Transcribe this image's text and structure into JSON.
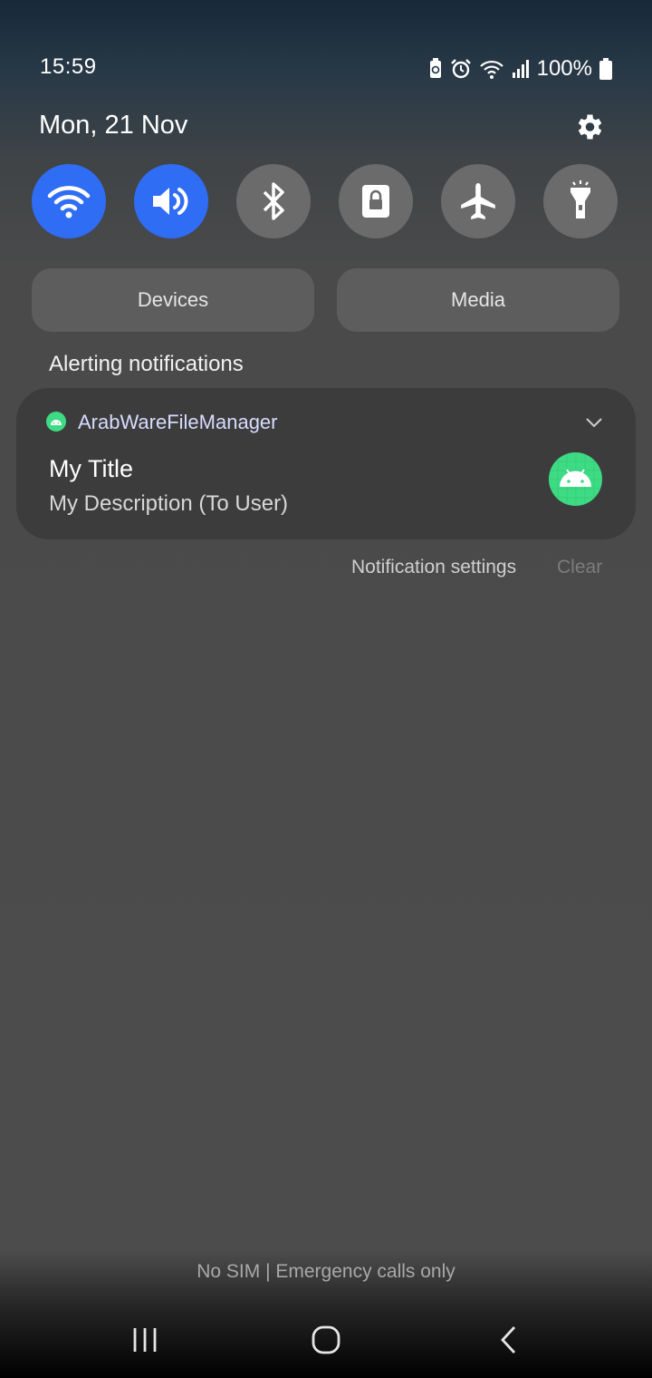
{
  "status_bar": {
    "time": "15:59",
    "battery_text": "100%",
    "icons": [
      "battery-saver-icon",
      "alarm-icon",
      "wifi-signal-icon",
      "cell-signal-icon",
      "battery-icon"
    ]
  },
  "header": {
    "date": "Mon, 21 Nov",
    "settings_icon": "gear-icon"
  },
  "quick_settings": [
    {
      "name": "wifi",
      "icon": "wifi-icon",
      "state": "on"
    },
    {
      "name": "sound",
      "icon": "volume-icon",
      "state": "on"
    },
    {
      "name": "bluetooth",
      "icon": "bluetooth-icon",
      "state": "off"
    },
    {
      "name": "auto-rotate-lock",
      "icon": "lock-icon",
      "state": "off"
    },
    {
      "name": "airplane-mode",
      "icon": "airplane-icon",
      "state": "off"
    },
    {
      "name": "flashlight",
      "icon": "flashlight-icon",
      "state": "off"
    }
  ],
  "pills": {
    "devices": "Devices",
    "media": "Media"
  },
  "notifications": {
    "section_title": "Alerting notifications",
    "items": [
      {
        "app_name": "ArabWareFileManager",
        "title": "My Title",
        "description": "My Description (To User)",
        "icon": "android-icon"
      }
    ],
    "settings_label": "Notification settings",
    "clear_label": "Clear"
  },
  "footer": {
    "carrier_text": "No SIM | Emergency calls only"
  },
  "navbar": {
    "recents": "recents-icon",
    "home": "home-icon",
    "back": "back-icon"
  },
  "colors": {
    "accent": "#2f6df5",
    "tile_off": "#6b6b6b",
    "android_green": "#3ddc84"
  }
}
